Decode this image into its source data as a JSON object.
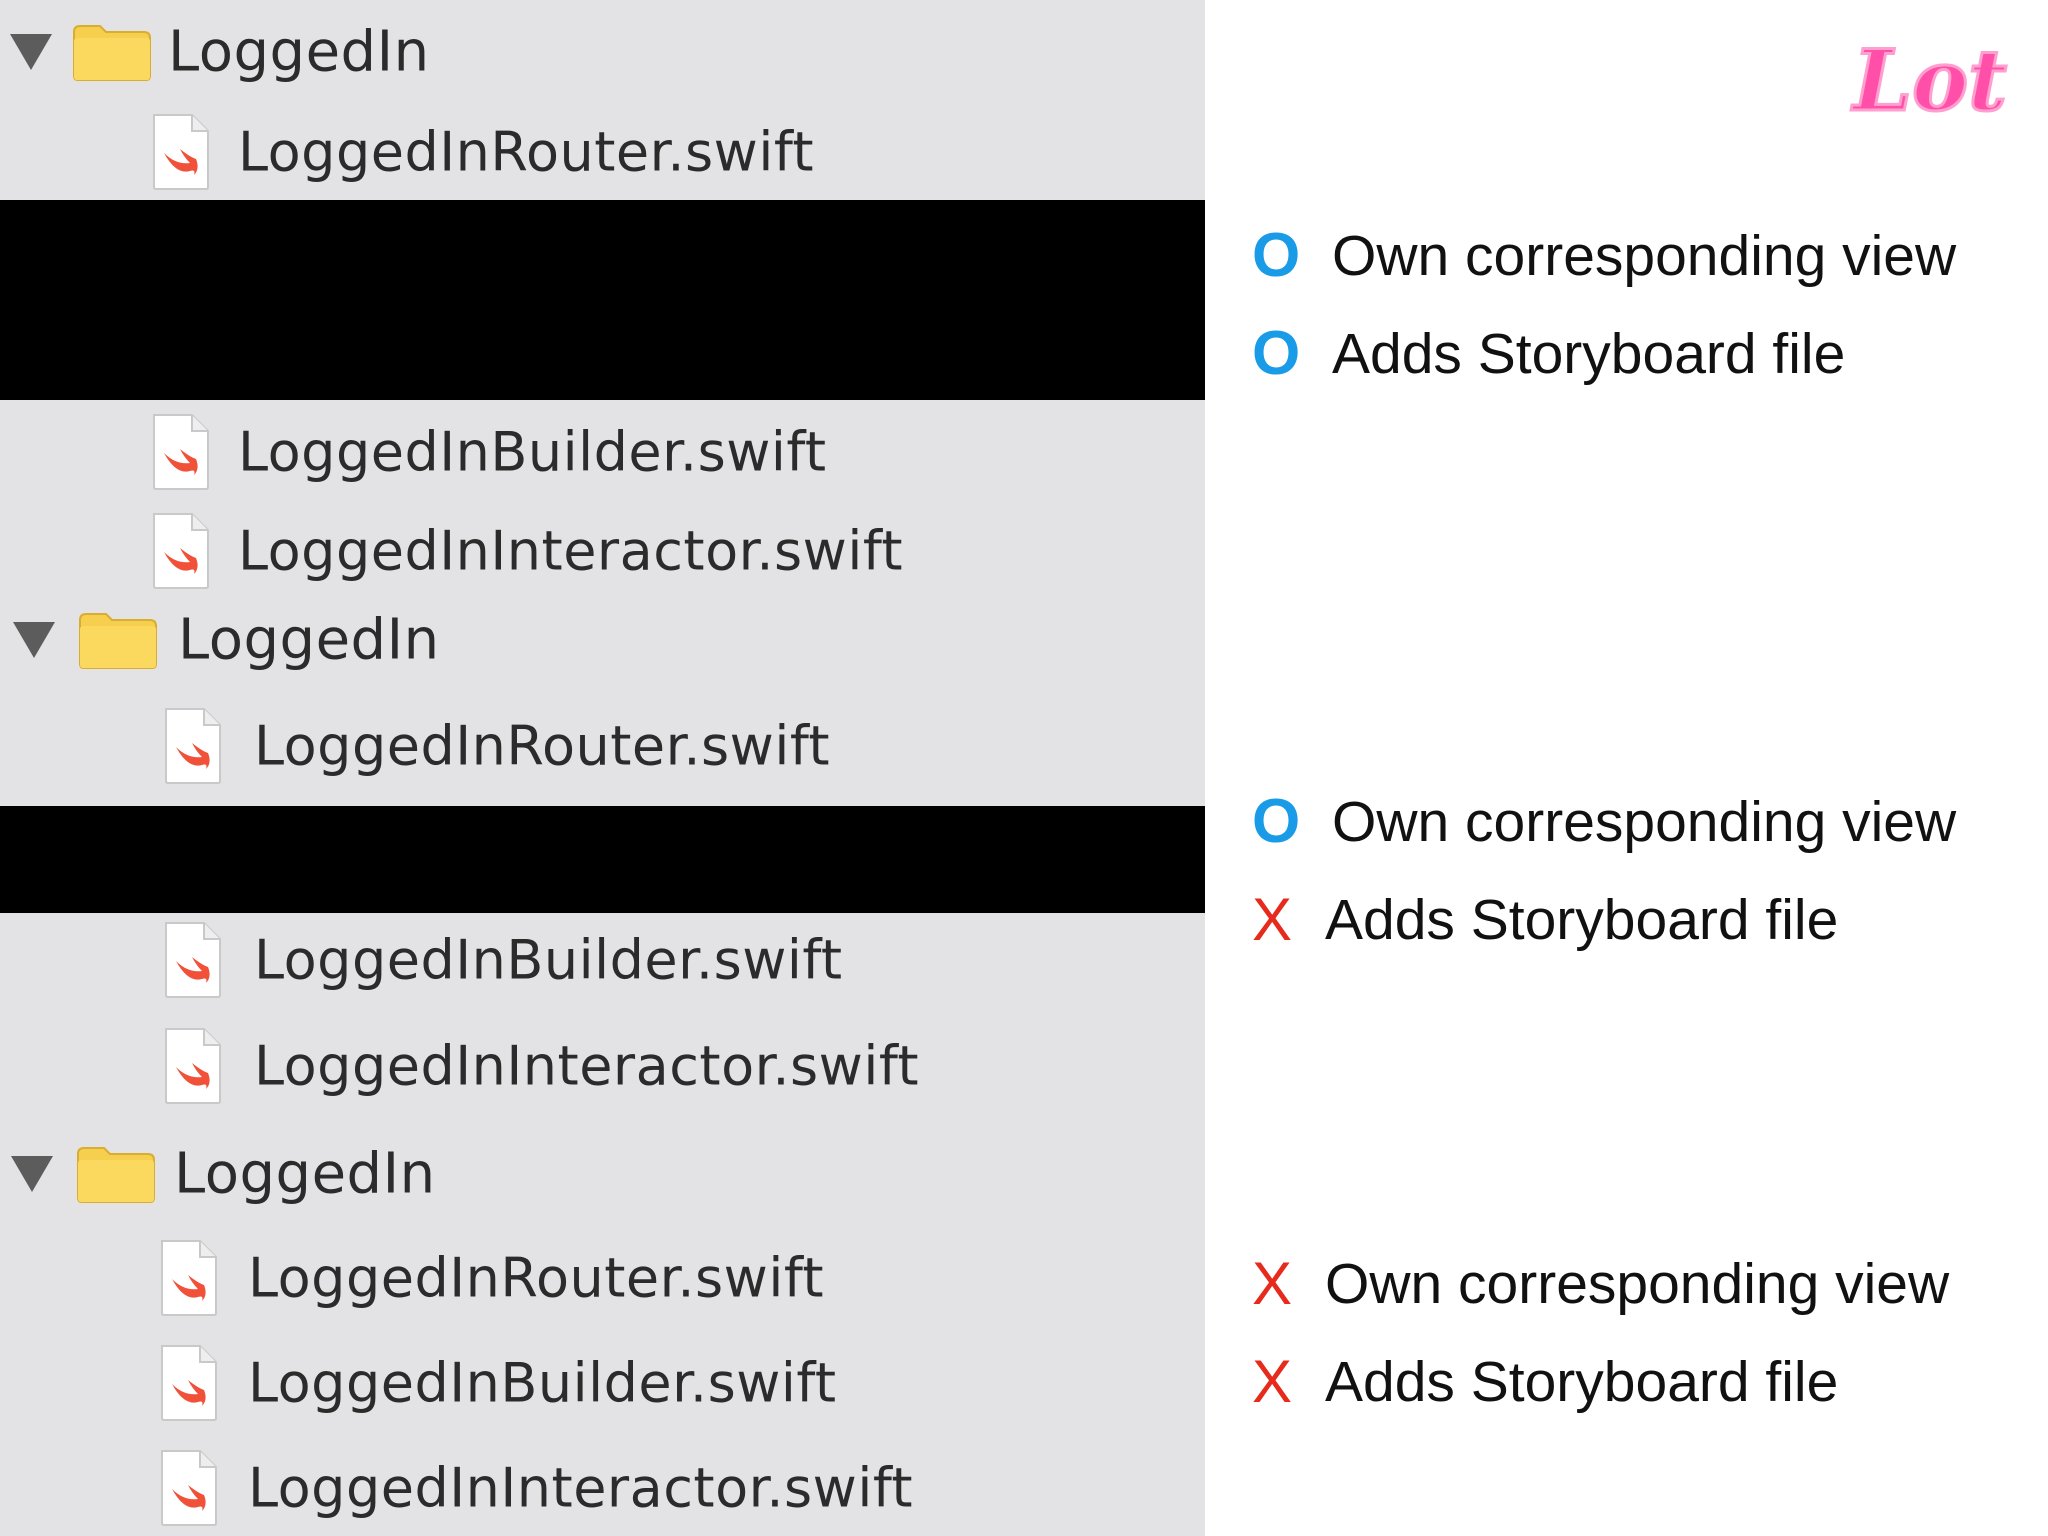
{
  "tree": {
    "groups": [
      {
        "folder": "LoggedIn",
        "files": [
          "LoggedInRouter.swift",
          "LoggedInBuilder.swift",
          "LoggedInInteractor.swift"
        ]
      },
      {
        "folder": "LoggedIn",
        "files": [
          "LoggedInRouter.swift",
          "LoggedInBuilder.swift",
          "LoggedInInteractor.swift"
        ]
      },
      {
        "folder": "LoggedIn",
        "files": [
          "LoggedInRouter.swift",
          "LoggedInBuilder.swift",
          "LoggedInInteractor.swift"
        ]
      }
    ]
  },
  "comparison": {
    "groups": [
      {
        "items": [
          {
            "mark": "O",
            "status": "yes",
            "text": "Own corresponding view"
          },
          {
            "mark": "O",
            "status": "yes",
            "text": "Adds Storyboard file"
          }
        ]
      },
      {
        "items": [
          {
            "mark": "O",
            "status": "yes",
            "text": "Own corresponding view"
          },
          {
            "mark": "X",
            "status": "no",
            "text": "Adds Storyboard file"
          }
        ]
      },
      {
        "items": [
          {
            "mark": "X",
            "status": "no",
            "text": "Own corresponding view"
          },
          {
            "mark": "X",
            "status": "no",
            "text": "Adds Storyboard file"
          }
        ]
      }
    ]
  },
  "logo": {
    "text": "Lot",
    "color": "#ff4fa8"
  },
  "colors": {
    "panel_bg": "#e3e3e5",
    "redaction": "#000000",
    "mark_yes": "#1a9be8",
    "mark_no": "#e62a1c",
    "folder": "#f7cf4e",
    "swift": "#f05138"
  },
  "icons": {
    "disclosure": "disclosure-triangle-icon",
    "folder": "folder-icon",
    "file": "swift-file-icon"
  }
}
